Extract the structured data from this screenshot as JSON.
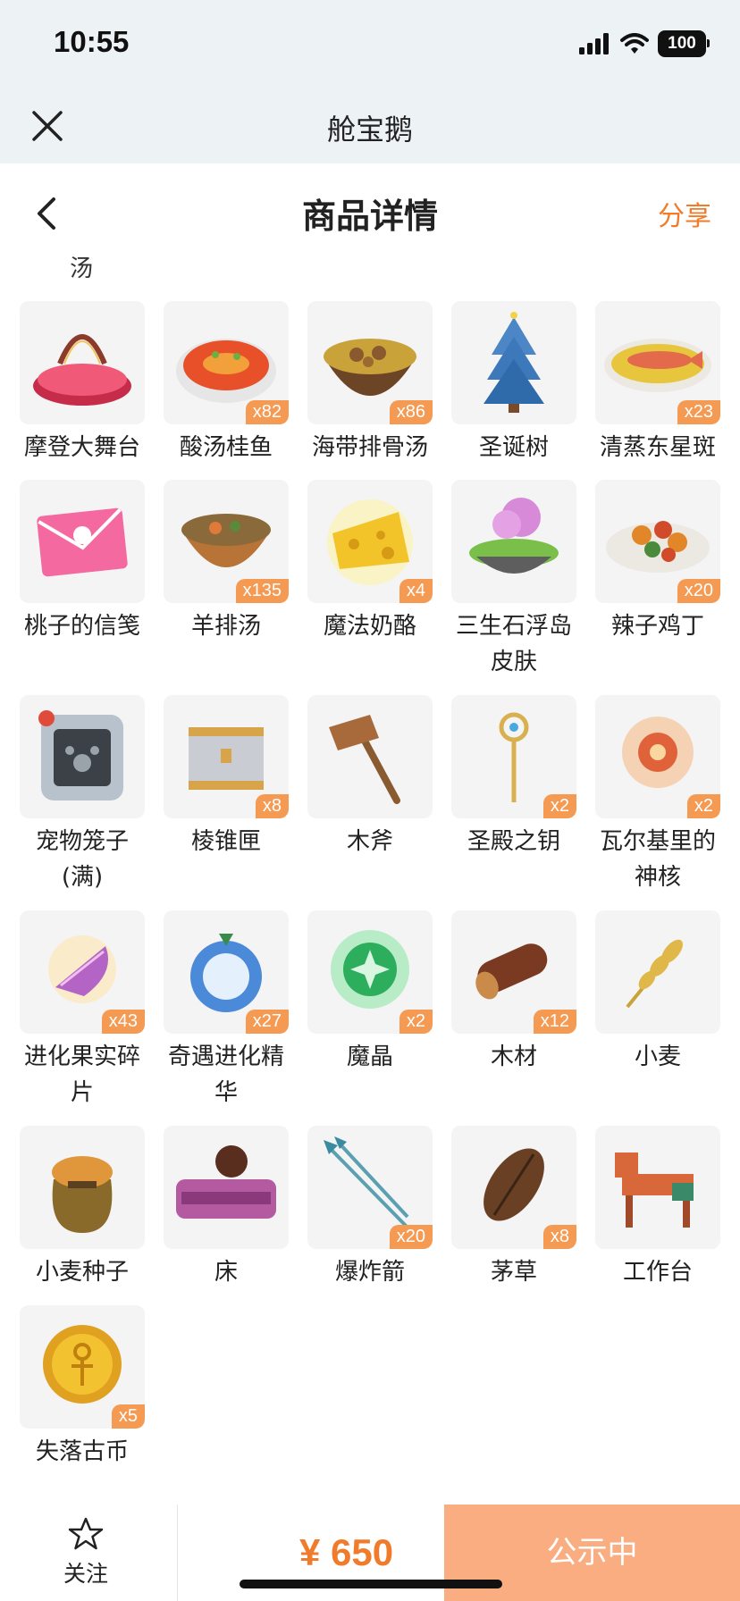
{
  "status_bar": {
    "time": "10:55",
    "battery": "100"
  },
  "nav": {
    "title": "舱宝鹅"
  },
  "header": {
    "title": "商品详情",
    "share": "分享"
  },
  "partial_text": "汤",
  "items": [
    {
      "name": "摩登大舞台",
      "qty": "",
      "icon": "stage-icon"
    },
    {
      "name": "酸汤桂鱼",
      "qty": "x82",
      "icon": "fish-soup-icon"
    },
    {
      "name": "海带排骨汤",
      "qty": "x86",
      "icon": "rib-soup-icon"
    },
    {
      "name": "圣诞树",
      "qty": "",
      "icon": "christmas-tree-icon"
    },
    {
      "name": "清蒸东星斑",
      "qty": "x23",
      "icon": "steamed-fish-icon"
    },
    {
      "name": "桃子的信笺",
      "qty": "",
      "icon": "letter-icon"
    },
    {
      "name": "羊排汤",
      "qty": "x135",
      "icon": "lamb-soup-icon"
    },
    {
      "name": "魔法奶酪",
      "qty": "x4",
      "icon": "cheese-icon"
    },
    {
      "name": "三生石浮岛皮肤",
      "qty": "",
      "icon": "floating-island-icon"
    },
    {
      "name": "辣子鸡丁",
      "qty": "x20",
      "icon": "spicy-chicken-icon"
    },
    {
      "name": "宠物笼子(满)",
      "qty": "",
      "icon": "pet-cage-icon"
    },
    {
      "name": "棱锥匣",
      "qty": "x8",
      "icon": "chest-icon"
    },
    {
      "name": "木斧",
      "qty": "",
      "icon": "wooden-axe-icon"
    },
    {
      "name": "圣殿之钥",
      "qty": "x2",
      "icon": "key-icon"
    },
    {
      "name": "瓦尔基里的神核",
      "qty": "x2",
      "icon": "core-icon"
    },
    {
      "name": "进化果实碎片",
      "qty": "x43",
      "icon": "fruit-shard-icon"
    },
    {
      "name": "奇遇进化精华",
      "qty": "x27",
      "icon": "essence-icon"
    },
    {
      "name": "魔晶",
      "qty": "x2",
      "icon": "magic-crystal-icon"
    },
    {
      "name": "木材",
      "qty": "x12",
      "icon": "log-icon"
    },
    {
      "name": "小麦",
      "qty": "",
      "icon": "wheat-icon"
    },
    {
      "name": "小麦种子",
      "qty": "",
      "icon": "seed-bag-icon"
    },
    {
      "name": "床",
      "qty": "",
      "icon": "bed-icon"
    },
    {
      "name": "爆炸箭",
      "qty": "x20",
      "icon": "arrow-icon"
    },
    {
      "name": "茅草",
      "qty": "x8",
      "icon": "thatch-icon"
    },
    {
      "name": "工作台",
      "qty": "",
      "icon": "workbench-icon"
    },
    {
      "name": "失落古币",
      "qty": "x5",
      "icon": "coin-icon"
    }
  ],
  "bottom": {
    "follow": "关注",
    "price": "¥ 650",
    "status": "公示中"
  }
}
